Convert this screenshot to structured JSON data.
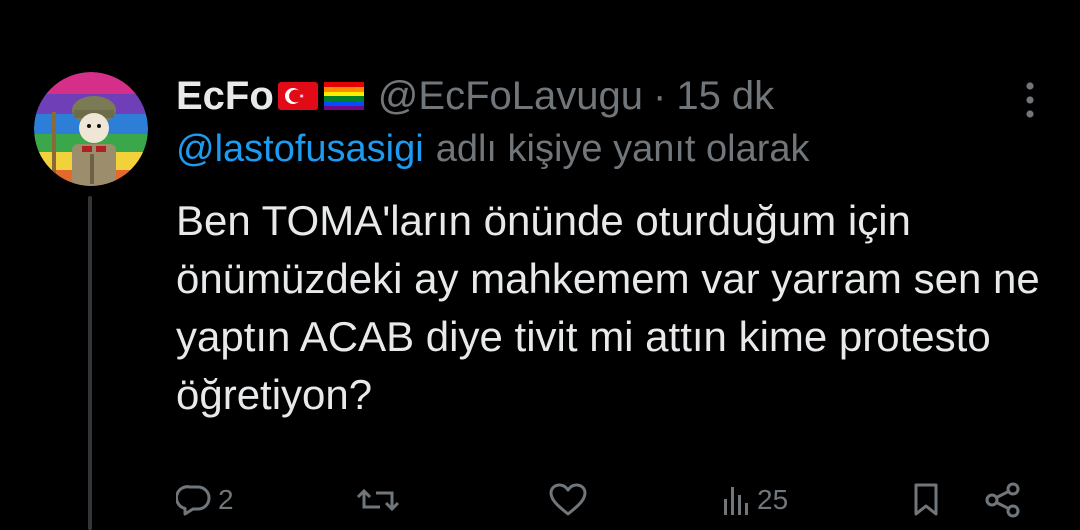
{
  "tweet": {
    "display_name": "EcFo",
    "handle": "@EcFoLavugu",
    "separator": "·",
    "time": "15 dk",
    "reply_to": "@lastofusasigi",
    "reply_suffix": "adlı kişiye yanıt olarak",
    "body": "Ben TOMA'ların önünde oturduğum için önümüzdeki ay mahkemem var yarram sen ne yaptın ACAB diye tivit mi attın kime protesto öğretiyon?",
    "flag_icons": [
      "turkey-flag-icon",
      "rainbow-flag-icon"
    ]
  },
  "actions": {
    "reply_count": "2",
    "retweet_count": "",
    "like_count": "",
    "view_count": "25"
  },
  "colors": {
    "background": "#000000",
    "text": "#e7e9ea",
    "muted": "#71767b",
    "mention": "#1d9bf0"
  }
}
